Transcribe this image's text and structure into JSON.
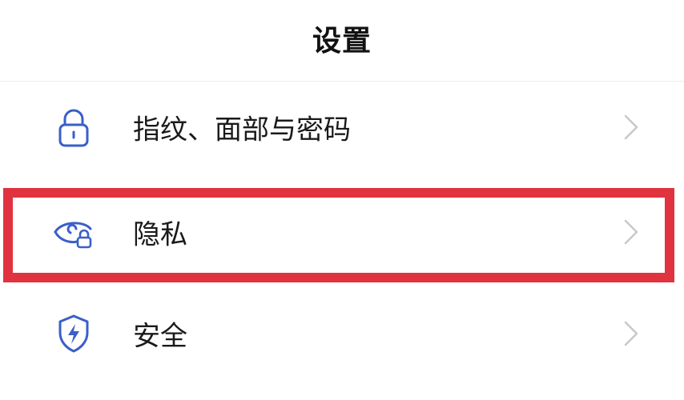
{
  "header": {
    "title": "设置"
  },
  "settings_items": [
    {
      "label": "指纹、面部与密码",
      "icon": "lock-icon"
    },
    {
      "label": "隐私",
      "icon": "eye-lock-icon"
    },
    {
      "label": "安全",
      "icon": "shield-bolt-icon"
    }
  ],
  "colors": {
    "icon_accent": "#3a5fc8",
    "highlight_border": "#e0323f",
    "chevron": "#c8c8c8",
    "divider": "#ededed"
  }
}
